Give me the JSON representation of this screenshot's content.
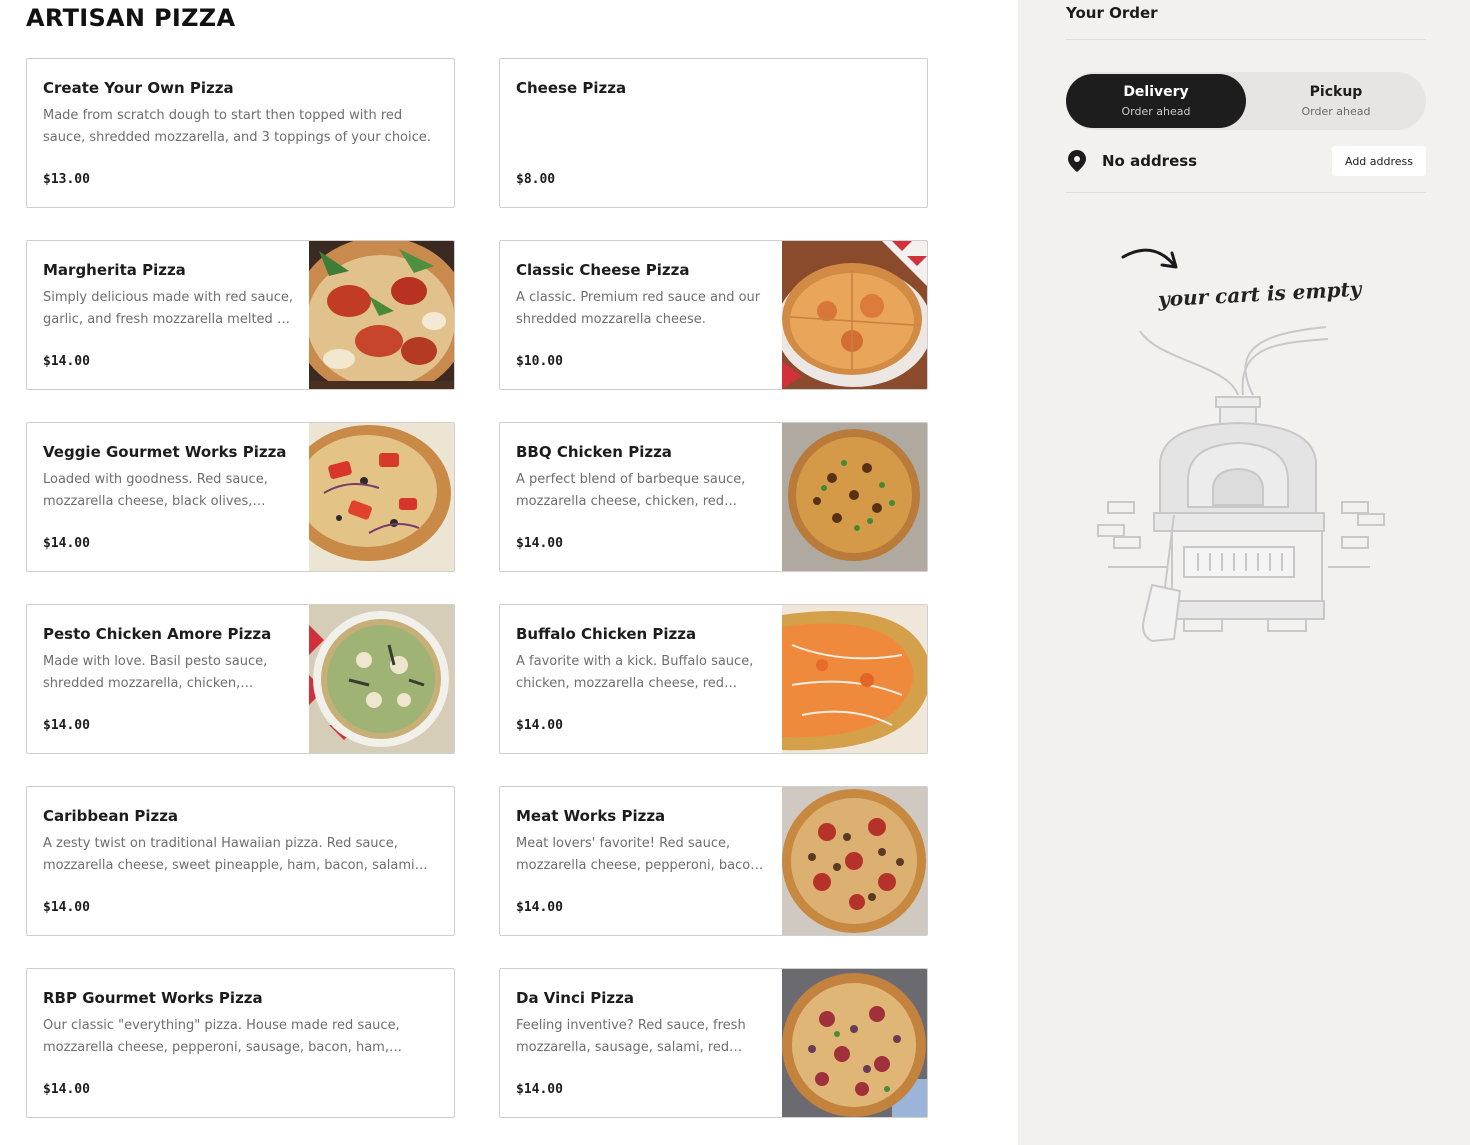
{
  "menu": {
    "section_title": "ARTISAN PIZZA",
    "items": [
      {
        "name": "Create Your Own Pizza",
        "description": "Made from scratch dough to start then topped with red sauce, shredded mozzarella, and 3 toppings of your choice.",
        "price": "$13.00"
      },
      {
        "name": "Cheese Pizza",
        "description": "",
        "price": "$8.00"
      },
      {
        "name": "Margherita Pizza",
        "description": "Simply delicious made with red sauce, garlic, and fresh mozzarella melted to perfection.",
        "price": "$14.00"
      },
      {
        "name": "Classic Cheese Pizza",
        "description": "A classic. Premium red sauce and our shredded mozzarella cheese.",
        "price": "$10.00"
      },
      {
        "name": "Veggie Gourmet Works Pizza",
        "description": "Loaded with goodness. Red sauce, mozzarella cheese, black olives, mushrooms, onions.",
        "price": "$14.00"
      },
      {
        "name": "BBQ Chicken Pizza",
        "description": "A perfect blend of barbeque sauce, mozzarella cheese, chicken, red onions.",
        "price": "$14.00"
      },
      {
        "name": "Pesto Chicken Amore Pizza",
        "description": "Made with love. Basil pesto sauce, shredded mozzarella, chicken, roasted peppers.",
        "price": "$14.00"
      },
      {
        "name": "Buffalo Chicken Pizza",
        "description": "A favorite with a kick. Buffalo sauce, chicken, mozzarella cheese, red onion, ranch.",
        "price": "$14.00"
      },
      {
        "name": "Caribbean Pizza",
        "description": "A zesty twist on traditional Hawaiian pizza. Red sauce, mozzarella cheese, sweet pineapple, ham, bacon, salami and jalapenos.",
        "price": "$14.00"
      },
      {
        "name": "Meat Works Pizza",
        "description": "Meat lovers' favorite! Red sauce, mozzarella cheese, pepperoni, bacon, sausage, ham.",
        "price": "$14.00"
      },
      {
        "name": "RBP Gourmet Works Pizza",
        "description": "Our classic \"everything\" pizza. House made red sauce, mozzarella cheese, pepperoni, sausage, bacon, ham, peppers.",
        "price": "$14.00"
      },
      {
        "name": "Da Vinci Pizza",
        "description": "Feeling inventive? Red sauce, fresh mozzarella, sausage, salami, red onions.",
        "price": "$14.00"
      }
    ]
  },
  "order": {
    "title": "Your Order",
    "delivery": {
      "label": "Delivery",
      "sub": "Order ahead"
    },
    "pickup": {
      "label": "Pickup",
      "sub": "Order ahead"
    },
    "address_status": "No address",
    "add_address_label": "Add address",
    "empty_cart_text": "your cart is empty"
  },
  "icons": {
    "location": "map-pin-icon",
    "arrow": "curved-arrow-icon"
  },
  "colors": {
    "sidebar_bg": "#f2f1ee",
    "toggle_active": "#1d1d1d",
    "card_border": "#cfcfcf"
  }
}
